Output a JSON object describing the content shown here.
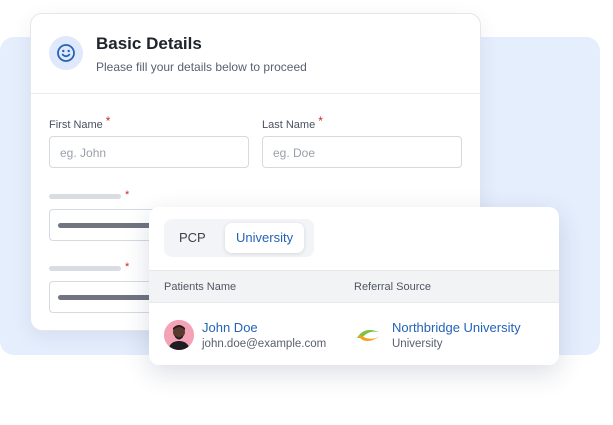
{
  "form": {
    "title": "Basic Details",
    "subtitle": "Please fill your details below to proceed",
    "first_name_label": "First Name",
    "first_name_placeholder": "eg. John",
    "last_name_label": "Last Name",
    "last_name_placeholder": "eg. Doe",
    "required_mark": "*"
  },
  "tabs": [
    "PCP",
    "University"
  ],
  "active_tab": "University",
  "table": {
    "columns": [
      "Patients Name",
      "Referral Source"
    ],
    "rows": [
      {
        "patient_name": "John Doe",
        "patient_email": "john.doe@example.com",
        "source_name": "Northbridge University",
        "source_type": "University"
      }
    ]
  },
  "colors": {
    "accent": "#2463b8",
    "background_panel": "#e5eefd",
    "required": "#d02a2a"
  },
  "icons": {
    "header": "smiley-face-icon",
    "source_logo": "university-logo-icon"
  }
}
